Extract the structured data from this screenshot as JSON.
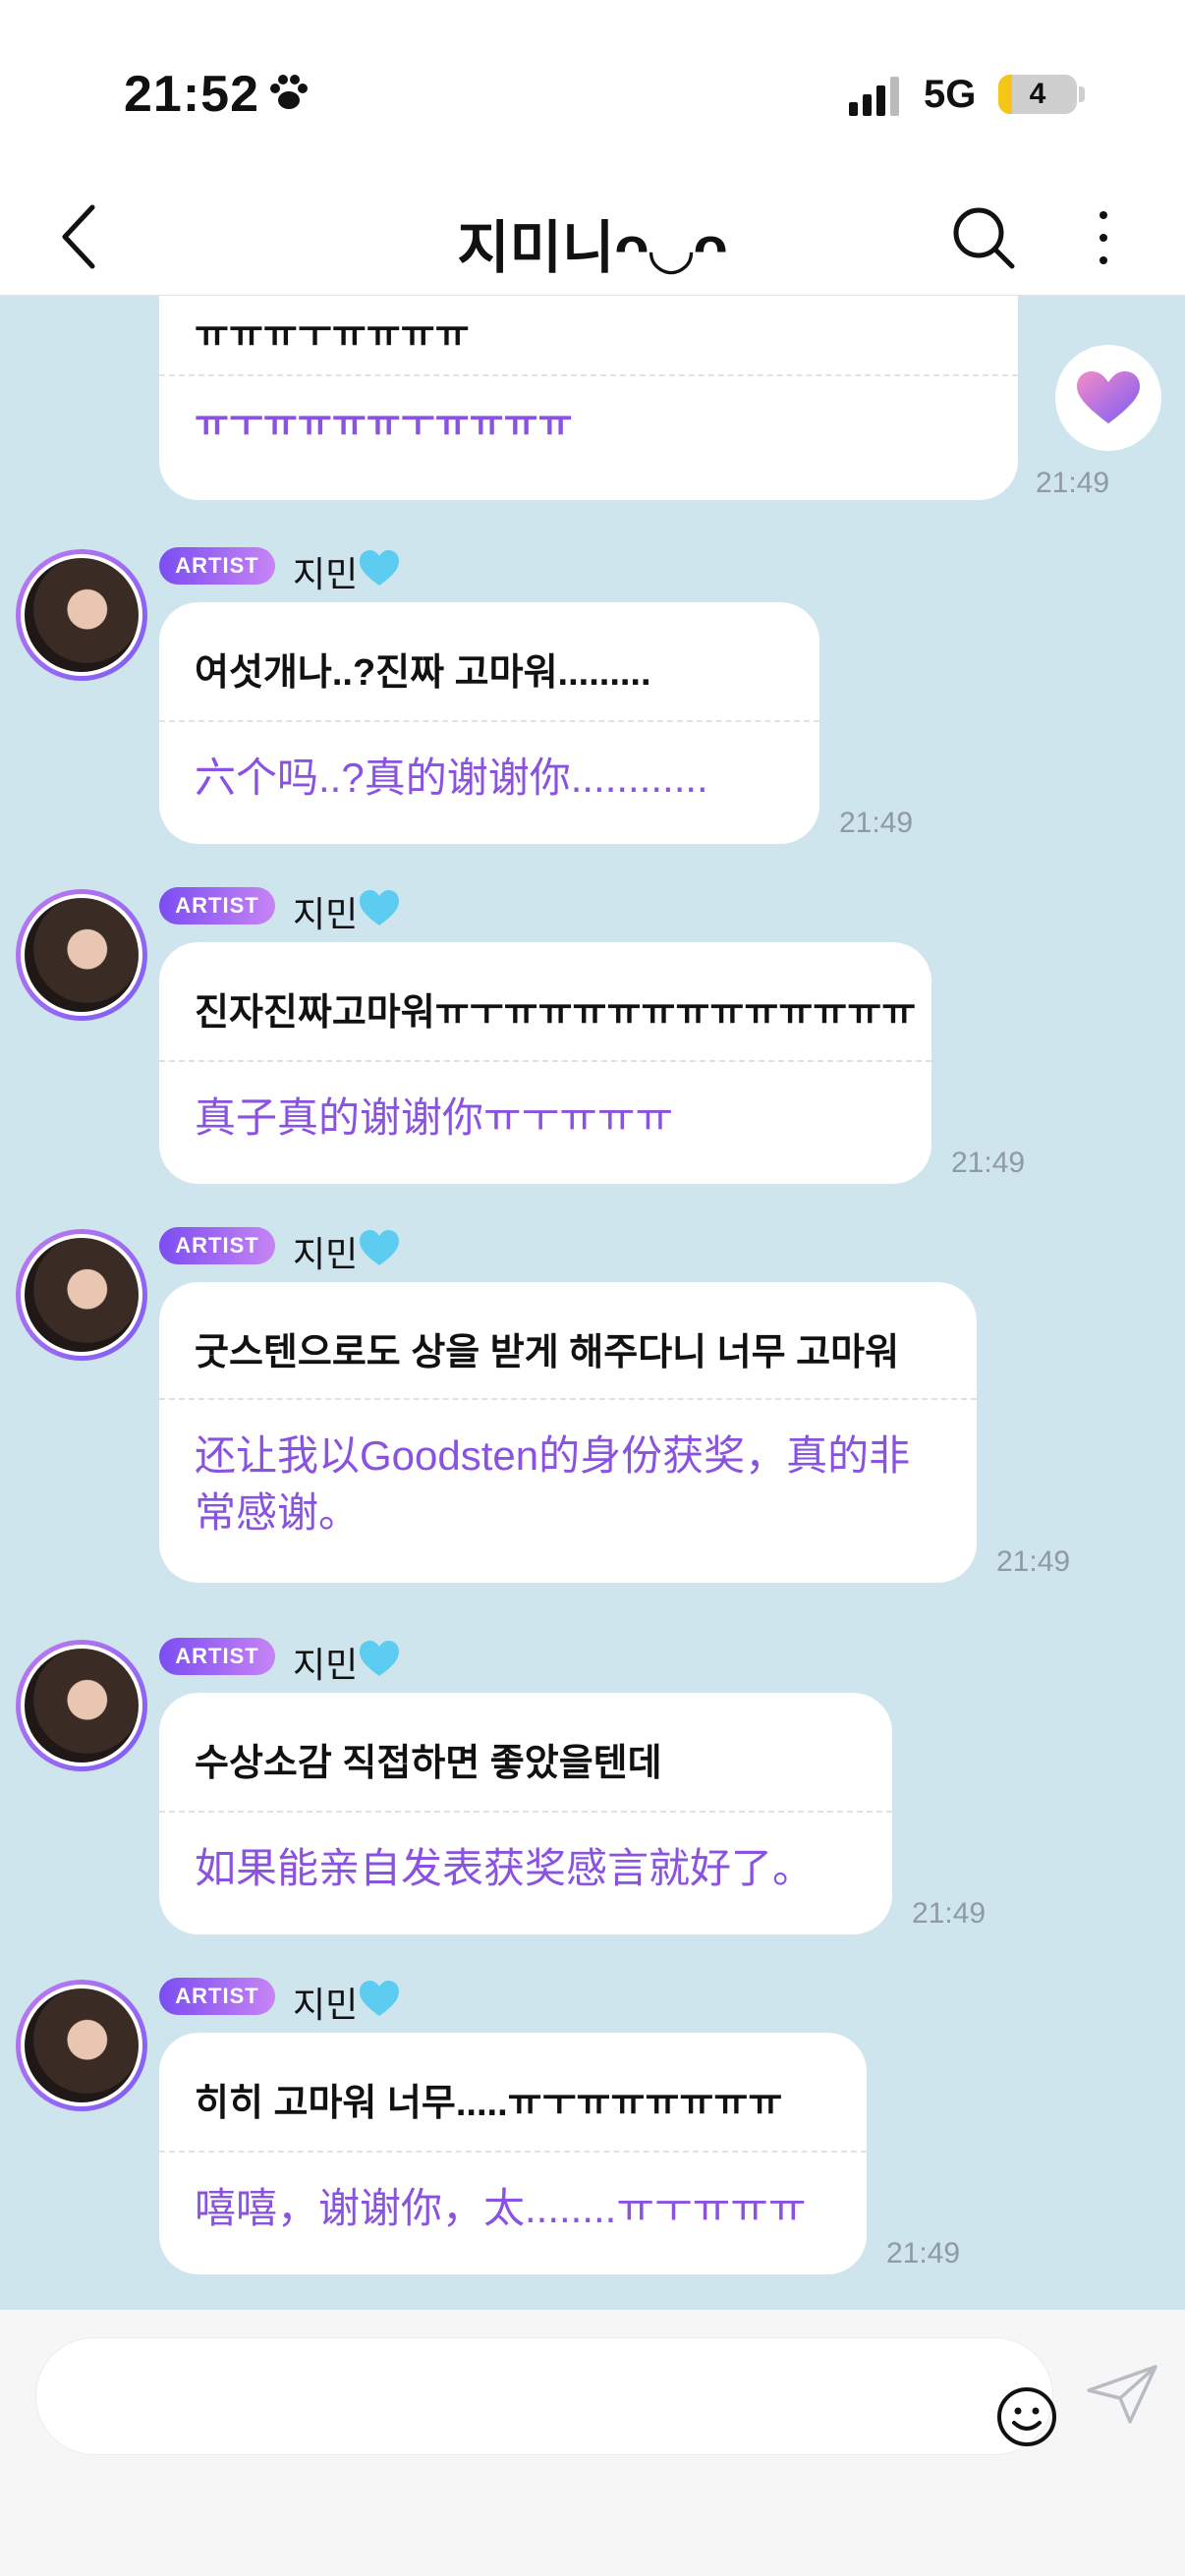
{
  "status_bar": {
    "time": "21:52",
    "network": "5G",
    "battery": "4"
  },
  "header": {
    "title": "지미니ᴖ◡ᴖ"
  },
  "sender_badge": "ARTIST",
  "sender_name": "지민",
  "messages": [
    {
      "original": "ㅠㅠㅠㅜㅠㅠㅠㅠ",
      "translation": "ㅠㅜㅠㅠㅠㅠㅜㅠㅠㅠㅠ",
      "time": "21:49"
    },
    {
      "original": "여섯개나..?진짜 고마워.........",
      "translation": "六个吗..?真的谢谢你............",
      "time": "21:49"
    },
    {
      "original": "진자진짜고마워ㅠㅜㅠㅠㅠㅠㅠㅠㅠㅠㅠㅠㅠㅠ",
      "translation": "真子真的谢谢你ㅠㅜㅠㅠㅠ",
      "time": "21:49"
    },
    {
      "original": "굿스텐으로도 상을 받게 해주다니 너무 고마워",
      "translation": "还让我以Goodsten的身份获奖，真的非常感谢。",
      "time": "21:49"
    },
    {
      "original": "수상소감 직접하면 좋았을텐데",
      "translation": "如果能亲自发表获奖感言就好了。",
      "time": "21:49"
    },
    {
      "original": "히히 고마워 너무.....ㅠㅜㅠㅠㅠㅠㅠㅠ",
      "translation": "嘻嘻，谢谢你，太........ㅠㅜㅠㅠㅠ",
      "time": "21:49"
    }
  ],
  "colors": {
    "chat_bg": "#cfe5ee",
    "translation": "#8a52e0",
    "badge_start": "#7b4df2",
    "badge_end": "#c784f4"
  },
  "icons": [
    "paw-icon",
    "signal-icon",
    "back-icon",
    "search-icon",
    "more-icon",
    "heart-icon",
    "emoji-icon",
    "send-icon"
  ]
}
